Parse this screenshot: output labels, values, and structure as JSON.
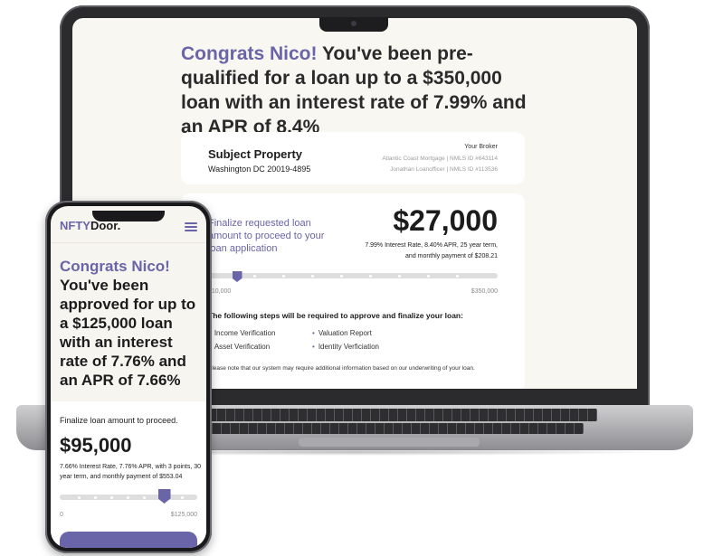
{
  "laptop": {
    "headline": {
      "accent": "Congrats Nico!",
      "rest": "You've been pre-qualified for a loan up to a $350,000 loan with an interest rate of 7.99% and an APR of 8.4%"
    },
    "property": {
      "title": "Subject Property",
      "address": "Washington DC 20019-4895",
      "broker_title": "Your Broker",
      "broker_line1": "Atlantic Coast Mortgage  |  NMLS ID #643114",
      "broker_line2": "Jonathan Loanofficer  |  NMLS ID #113536"
    },
    "loan": {
      "prompt": "Finalize requested loan amount to proceed to your loan application",
      "amount": "$27,000",
      "description": "7.99% Interest Rate, 8.40% APR, 25 year term, and monthly payment of $208.21",
      "slider_min": "$10,000",
      "slider_max": "$350,000",
      "slider_fraction": 0.1
    },
    "steps": {
      "title": "The following steps will be required to approve and finalize your loan:",
      "items": [
        "Income Verification",
        "Valuation Report",
        "Asset Verification",
        "Identity Verficiation"
      ]
    },
    "note": "Please note that our system may require additional information based on our underwriting of your loan."
  },
  "phone": {
    "brand_a": "NFTY",
    "brand_b": "Door.",
    "headline": {
      "accent": "Congrats Nico!",
      "rest": "You've been approved for up to a $125,000 loan with an interest rate of 7.76% and an APR of 7.66%"
    },
    "loan": {
      "prompt": "Finalize loan amount to proceed.",
      "amount": "$95,000",
      "description": "7.66% Interest Rate, 7.76% APR, with 3 points, 30 year term, and monthly payment of $553.04",
      "slider_min": "0",
      "slider_max": "$125,000",
      "slider_fraction": 0.76
    }
  },
  "colors": {
    "accent": "#6a64a8",
    "background": "#f8f7f1"
  }
}
